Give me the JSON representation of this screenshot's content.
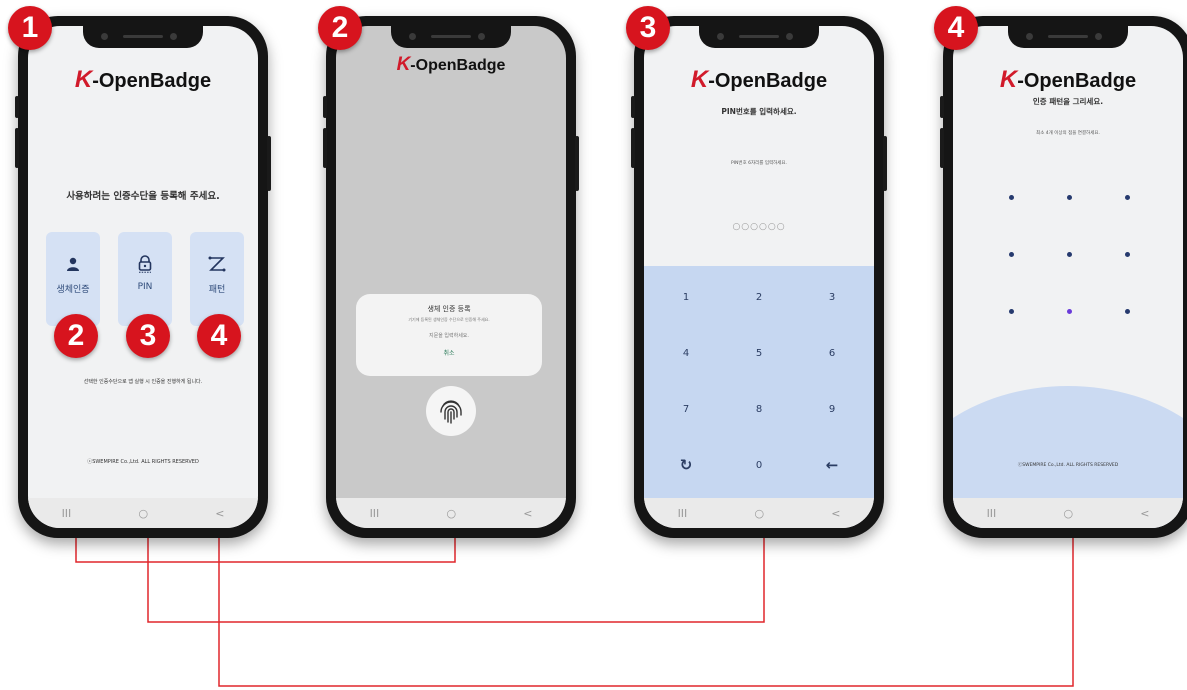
{
  "brand": {
    "logo_k": "K",
    "logo_rest": "-OpenBadge"
  },
  "step_badges": [
    "1",
    "2",
    "3",
    "4"
  ],
  "screen1": {
    "title": "사용하려는 인증수단을 등록해 주세요.",
    "methods": [
      {
        "label": "생체인증",
        "icon": "person-icon",
        "badge": "2"
      },
      {
        "label": "PIN",
        "icon": "lock-icon",
        "badge": "3"
      },
      {
        "label": "패턴",
        "icon": "pattern-icon",
        "badge": "4"
      }
    ],
    "note": "선택한 인증수단으로 앱 실행 시 인증을 진행하게 됩니다.",
    "copyright": "ⓒSWEMPIRE Co.,Ltd. ALL RIGHTS RESERVED"
  },
  "screen2": {
    "dialog_title": "생체 인증 등록",
    "dialog_sub": "기기에 등록된 생체인증 수단으로 인증해 주세요.",
    "dialog_hint": "지문을 입력하세요.",
    "cancel": "취소"
  },
  "screen3": {
    "title": "PIN번호를 입력하세요.",
    "subtitle": "PIN번호 6자리를 입력하세요.",
    "pin_dots": "○○○○○○",
    "keys": [
      "1",
      "2",
      "3",
      "4",
      "5",
      "6",
      "7",
      "8",
      "9",
      "0"
    ],
    "refresh_icon": "↻",
    "back_icon": "←"
  },
  "screen4": {
    "title": "인증 패턴을 그리세요.",
    "subtitle": "최소 4개 이상의 점을 연결하세요.",
    "copyright": "ⓒSWEMPIRE Co.,Ltd. ALL RIGHTS RESERVED"
  },
  "navbar": {
    "recent": "III",
    "home": "○",
    "back": "<"
  },
  "colors": {
    "accent_red": "#d7141e",
    "card_blue": "#d5e1f4",
    "keypad_blue": "#c6d7f1",
    "connector": "#e0262c"
  }
}
